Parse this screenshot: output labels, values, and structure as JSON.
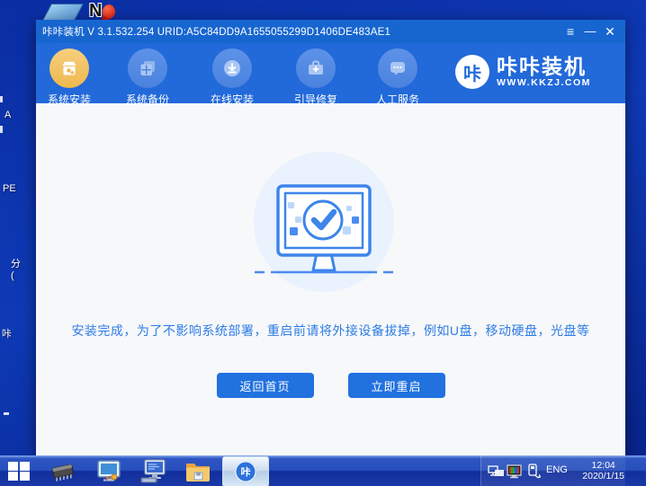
{
  "desktop": {
    "shortcut_labels": {
      "fragment_1": "A",
      "fragment_2": "PE",
      "fragment_3": "分",
      "fragment_4": "(",
      "fragment_5": "咔"
    },
    "notepad_letter": "N"
  },
  "window": {
    "titlebar": {
      "title": "咔咔装机 V 3.1.532.254 URID:A5C84DD9A1655055299D1406DE483AE1",
      "menu_glyph": "≡",
      "minimize_glyph": "—",
      "close_glyph": "✕"
    },
    "nav": {
      "items": [
        {
          "label": "系统安装",
          "icon": "install-package-icon",
          "active": true
        },
        {
          "label": "系统备份",
          "icon": "system-backup-icon",
          "active": false
        },
        {
          "label": "在线安装",
          "icon": "online-install-download-icon",
          "active": false
        },
        {
          "label": "引导修复",
          "icon": "boot-repair-toolbox-icon",
          "active": false
        },
        {
          "label": "人工服务",
          "icon": "live-support-chat-icon",
          "active": false
        }
      ],
      "logo": {
        "badge": "咔",
        "title": "咔咔装机",
        "subtitle": "WWW.KKZJ.COM"
      }
    },
    "content": {
      "message": "安装完成，为了不影响系统部署，重启前请将外接设备拔掉，例如U盘，移动硬盘，光盘等",
      "home_button": "返回首页",
      "restart_button": "立即重启"
    }
  },
  "taskbar": {
    "kaka_badge": "咔",
    "tray": {
      "language": "ENG",
      "time": "12:04",
      "date": "2020/1/15"
    }
  },
  "colors": {
    "titlebar": "#1766d0",
    "navbar": "#2269da",
    "accent_blue": "#2171df",
    "active_gold": "#f3c568",
    "message_blue": "#2f7ce5",
    "desktop_blue": "#0c32aa"
  }
}
